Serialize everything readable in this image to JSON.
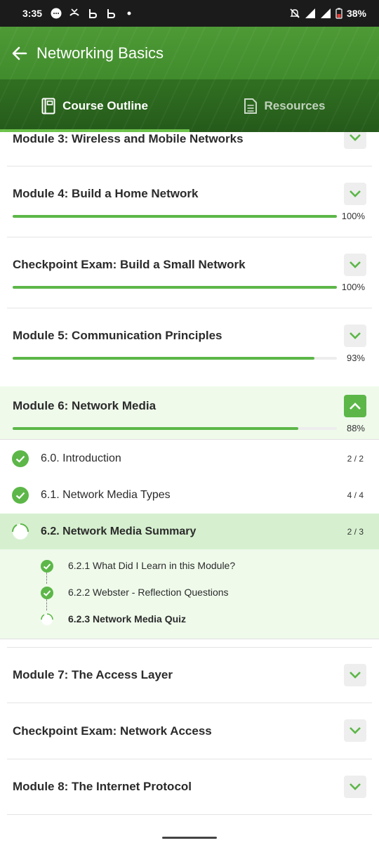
{
  "status_bar": {
    "time": "3:35",
    "battery": "38%"
  },
  "header": {
    "title": "Networking Basics"
  },
  "tabs": [
    {
      "label": "Course Outline",
      "active": true
    },
    {
      "label": "Resources",
      "active": false
    }
  ],
  "modules": [
    {
      "title": "Module 3: Wireless and Mobile Networks"
    },
    {
      "title": "Module 4: Build a Home Network",
      "progress": 1.0,
      "percent": "100%"
    },
    {
      "title": "Checkpoint Exam: Build a Small Network",
      "progress": 1.0,
      "percent": "100%"
    },
    {
      "title": "Module 5: Communication Principles",
      "progress": 0.93,
      "percent": "93%"
    },
    {
      "title": "Module 6: Network Media",
      "progress": 0.88,
      "percent": "88%",
      "expanded": true
    }
  ],
  "sections": [
    {
      "label": "6.0. Introduction",
      "count": "2 / 2",
      "status": "complete"
    },
    {
      "label": "6.1. Network Media Types",
      "count": "4 / 4",
      "status": "complete"
    },
    {
      "label": "6.2. Network Media Summary",
      "count": "2 / 3",
      "status": "in-progress"
    }
  ],
  "topics": [
    {
      "label": "6.2.1 What Did I Learn in this Module?",
      "status": "complete"
    },
    {
      "label": "6.2.2 Webster - Reflection Questions",
      "status": "complete"
    },
    {
      "label": "6.2.3 Network Media Quiz",
      "status": "current"
    }
  ],
  "more_modules": [
    {
      "title": "Module 7: The Access Layer"
    },
    {
      "title": "Checkpoint Exam: Network Access"
    },
    {
      "title": "Module 8: The Internet Protocol"
    }
  ],
  "colors": {
    "accent": "#5cb748",
    "header": "#3f8a2b",
    "current_row": "#d6f0cf",
    "topic_bg": "#effaeb"
  }
}
